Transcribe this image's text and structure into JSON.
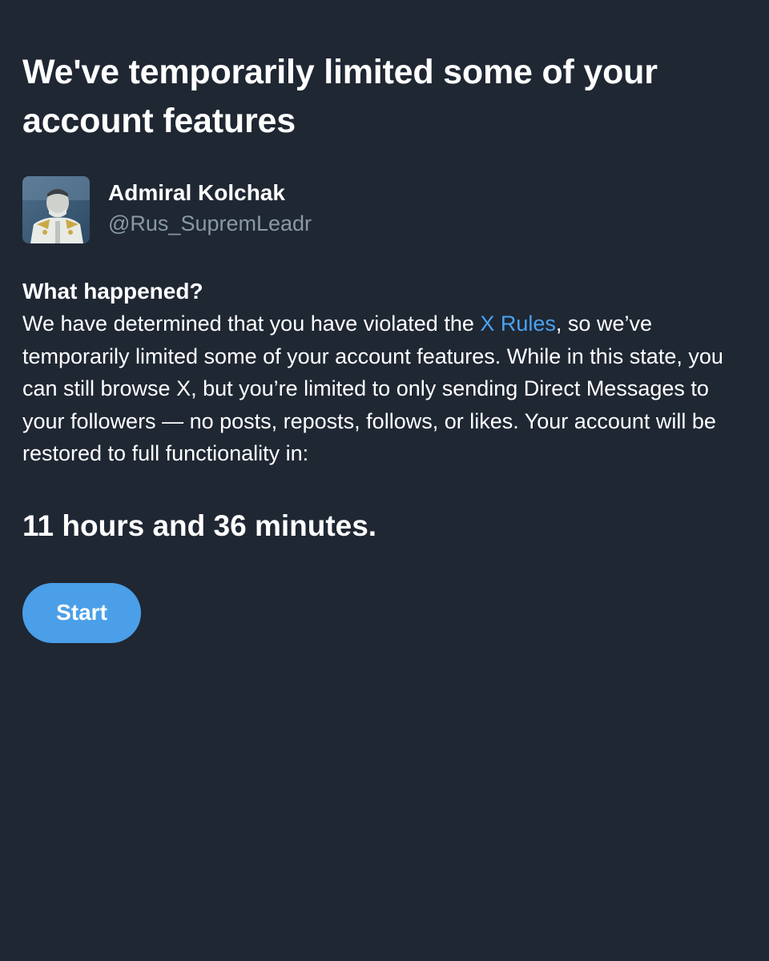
{
  "header": {
    "title": "We've temporarily limited some of your account features"
  },
  "profile": {
    "display_name": "Admiral Kolchak",
    "handle": "@Rus_SupremLeadr",
    "avatar_icon": "portrait-photo"
  },
  "notice": {
    "heading": "What happened?",
    "text_before_link": "We have determined that you have violated the ",
    "link_text": "X Rules",
    "text_after_link": ", so we’ve temporarily limited some of your account features. While in this state, you can still browse X, but you’re limited to only sending Direct Messages to your followers — no posts, reposts, follows, or likes. Your account will be restored to full functionality in:",
    "countdown": "11 hours and 36 minutes."
  },
  "actions": {
    "start_label": "Start"
  },
  "colors": {
    "background": "#1f2733",
    "text": "#ffffff",
    "muted": "#8899a6",
    "link": "#4aa3f0",
    "button": "#4a9fe8"
  }
}
